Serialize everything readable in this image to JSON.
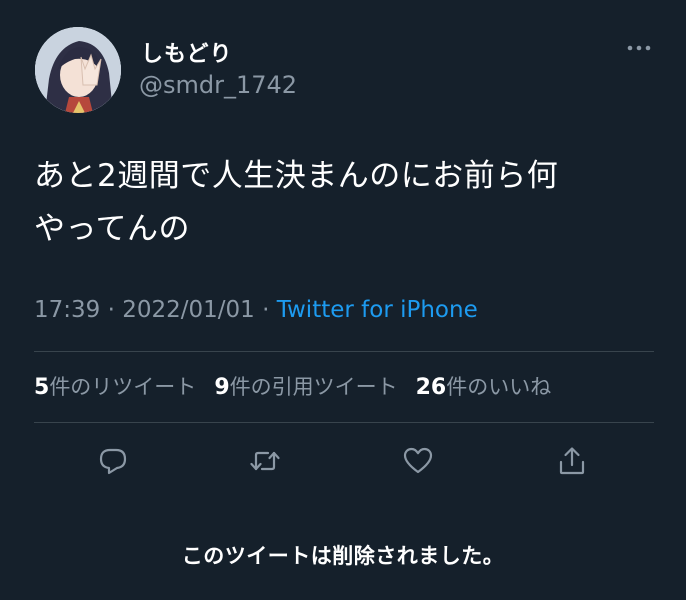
{
  "user": {
    "display_name": "しもどり",
    "handle": "@smdr_1742",
    "avatar_icon": "anime-character-avatar"
  },
  "tweet": {
    "text_line1": "あと2週間で人生決まんのにお前ら何",
    "text_line2": "やってんの",
    "time": "17:39",
    "separator1": " · ",
    "date": "2022/01/01",
    "separator2": " · ",
    "source": "Twitter for iPhone"
  },
  "stats": {
    "retweets_count": "5",
    "retweets_label": "件のリツイート",
    "quotes_count": "9",
    "quotes_label": "件の引用ツイート",
    "likes_count": "26",
    "likes_label": "件のいいね"
  },
  "actions": {
    "reply_icon": "reply-icon",
    "retweet_icon": "retweet-icon",
    "like_icon": "heart-icon",
    "share_icon": "share-icon"
  },
  "notice": "このツイートは削除されました。",
  "colors": {
    "background": "#15202b",
    "text_primary": "#ffffff",
    "text_secondary": "#8b98a5",
    "link": "#1d9bf0",
    "divider": "#38444d"
  }
}
